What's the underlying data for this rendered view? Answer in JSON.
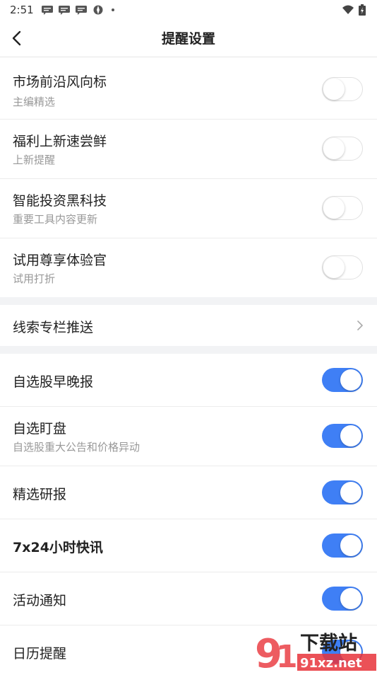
{
  "status": {
    "time": "2:51"
  },
  "header": {
    "title": "提醒设置"
  },
  "group1": [
    {
      "label": "市场前沿风向标",
      "sub": "主编精选",
      "on": false
    },
    {
      "label": "福利上新速尝鲜",
      "sub": "上新提醒",
      "on": false
    },
    {
      "label": "智能投资黑科技",
      "sub": "重要工具内容更新",
      "on": false
    },
    {
      "label": "试用尊享体验官",
      "sub": "试用打折",
      "on": false
    }
  ],
  "nav_row": {
    "label": "线索专栏推送"
  },
  "group2": [
    {
      "label": "自选股早晚报",
      "sub": "",
      "on": true
    },
    {
      "label": "自选盯盘",
      "sub": "自选股重大公告和价格异动",
      "on": true
    },
    {
      "label": "精选研报",
      "sub": "",
      "on": true
    },
    {
      "label": "7x24小时快讯",
      "sub": "",
      "on": true
    },
    {
      "label": "活动通知",
      "sub": "",
      "on": true
    },
    {
      "label": "日历提醒",
      "sub": "",
      "on": true
    }
  ],
  "watermark": {
    "text1": "下载站",
    "text2": "91xz.net"
  },
  "colors": {
    "accent": "#3f7ff5",
    "divider": "#f2f3f5"
  }
}
